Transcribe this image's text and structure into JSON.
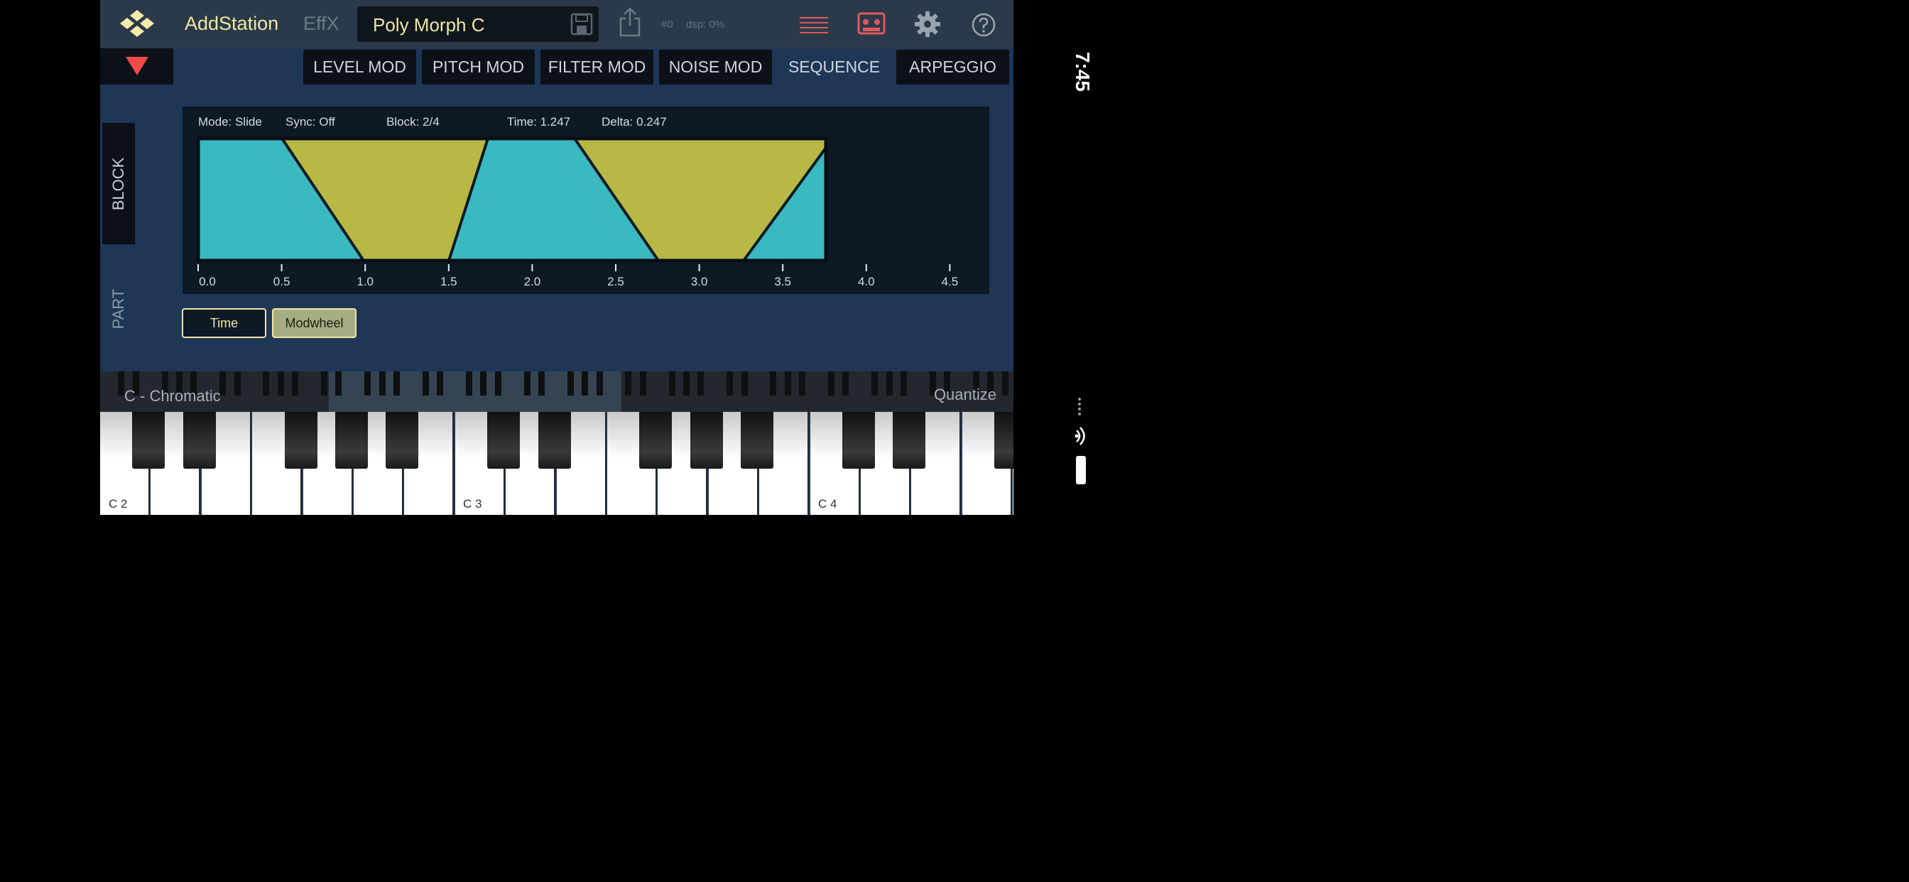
{
  "status_bar": {
    "time": "7:45"
  },
  "topbar": {
    "logo_icon": "diamond-grid-logo",
    "app_title": "AddStation",
    "effx_label": "EffX",
    "preset_name": "Poly Morph C",
    "status_num": "#0",
    "status_dsp": "dsp: 0%",
    "icons": [
      "save-icon",
      "share-icon",
      "menu-lines-icon",
      "tape-icon",
      "gear-icon",
      "help-icon"
    ]
  },
  "tabs": [
    {
      "label": "LEVEL MOD",
      "active": false
    },
    {
      "label": "PITCH MOD",
      "active": false
    },
    {
      "label": "FILTER MOD",
      "active": false
    },
    {
      "label": "NOISE MOD",
      "active": false
    },
    {
      "label": "SEQUENCE",
      "active": true
    },
    {
      "label": "ARPEGGIO",
      "active": false
    }
  ],
  "side": {
    "block_label": "BLOCK",
    "part_label": "PART"
  },
  "sequence": {
    "mode": "Mode: Slide",
    "sync": "Sync: Off",
    "block": "Block: 2/4",
    "time": "Time: 1.247",
    "delta": "Delta: 0.247",
    "x_ticks": [
      "0.0",
      "0.5",
      "1.0",
      "1.5",
      "2.0",
      "2.5",
      "3.0",
      "3.5",
      "4.0",
      "4.5"
    ],
    "colors": {
      "teal": "#3ab9c1",
      "olive": "#b7b944",
      "panel": "#0e1926"
    }
  },
  "buttons": {
    "time": "Time",
    "modwheel": "Modwheel"
  },
  "keyboard": {
    "scale": "C - Chromatic",
    "quantize": "Quantize",
    "note_labels": [
      "C 2",
      "C 3",
      "C 4"
    ]
  }
}
